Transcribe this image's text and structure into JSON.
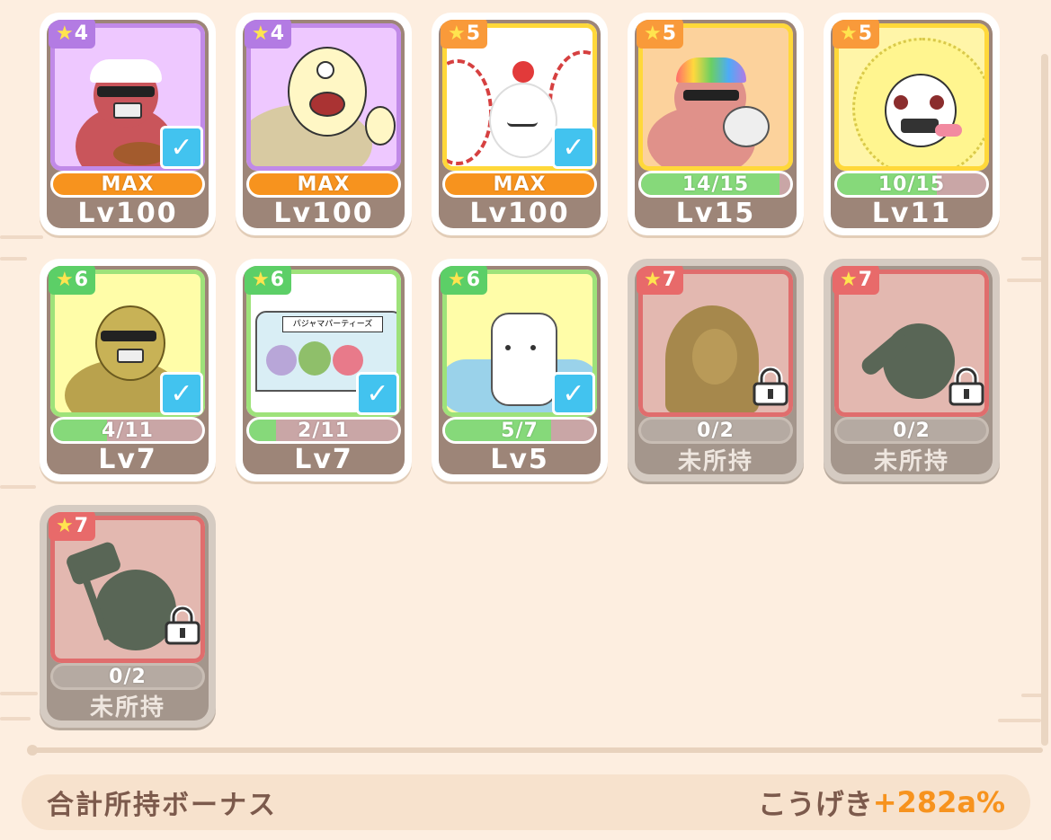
{
  "colors": {
    "background": "#fdeee0",
    "max_bar": "#f7931e",
    "progress_fill": "#86d97a",
    "check": "#42c3ef",
    "rarity4": "#b37be3",
    "rarity5": "#f99a3a",
    "rarity6": "#5ccf67",
    "rarity7": "#e86a6a"
  },
  "cards": [
    {
      "stars": "4",
      "bar": "MAX",
      "level": "Lv100",
      "selected": true,
      "locked": false,
      "progress": 1.0
    },
    {
      "stars": "4",
      "bar": "MAX",
      "level": "Lv100",
      "selected": false,
      "locked": false,
      "progress": 1.0
    },
    {
      "stars": "5",
      "bar": "MAX",
      "level": "Lv100",
      "selected": true,
      "locked": false,
      "progress": 1.0
    },
    {
      "stars": "5",
      "bar": "14/15",
      "level": "Lv15",
      "selected": false,
      "locked": false,
      "progress": 0.93
    },
    {
      "stars": "5",
      "bar": "10/15",
      "level": "Lv11",
      "selected": false,
      "locked": false,
      "progress": 0.67
    },
    {
      "stars": "6",
      "bar": "4/11",
      "level": "Lv7",
      "selected": true,
      "locked": false,
      "progress": 0.36
    },
    {
      "stars": "6",
      "bar": "2/11",
      "level": "Lv7",
      "selected": true,
      "locked": false,
      "progress": 0.18
    },
    {
      "stars": "6",
      "bar": "5/7",
      "level": "Lv5",
      "selected": true,
      "locked": false,
      "progress": 0.71
    },
    {
      "stars": "7",
      "bar": "0/2",
      "level": "未所持",
      "selected": false,
      "locked": true,
      "progress": 0
    },
    {
      "stars": "7",
      "bar": "0/2",
      "level": "未所持",
      "selected": false,
      "locked": true,
      "progress": 0
    },
    {
      "stars": "7",
      "bar": "0/2",
      "level": "未所持",
      "selected": false,
      "locked": true,
      "progress": 0
    }
  ],
  "card_art_text": {
    "party_sign": "パジャマパーティーズ"
  },
  "bonus": {
    "label": "合計所持ボーナス",
    "stat": "こうげき",
    "value": "+282a%"
  }
}
